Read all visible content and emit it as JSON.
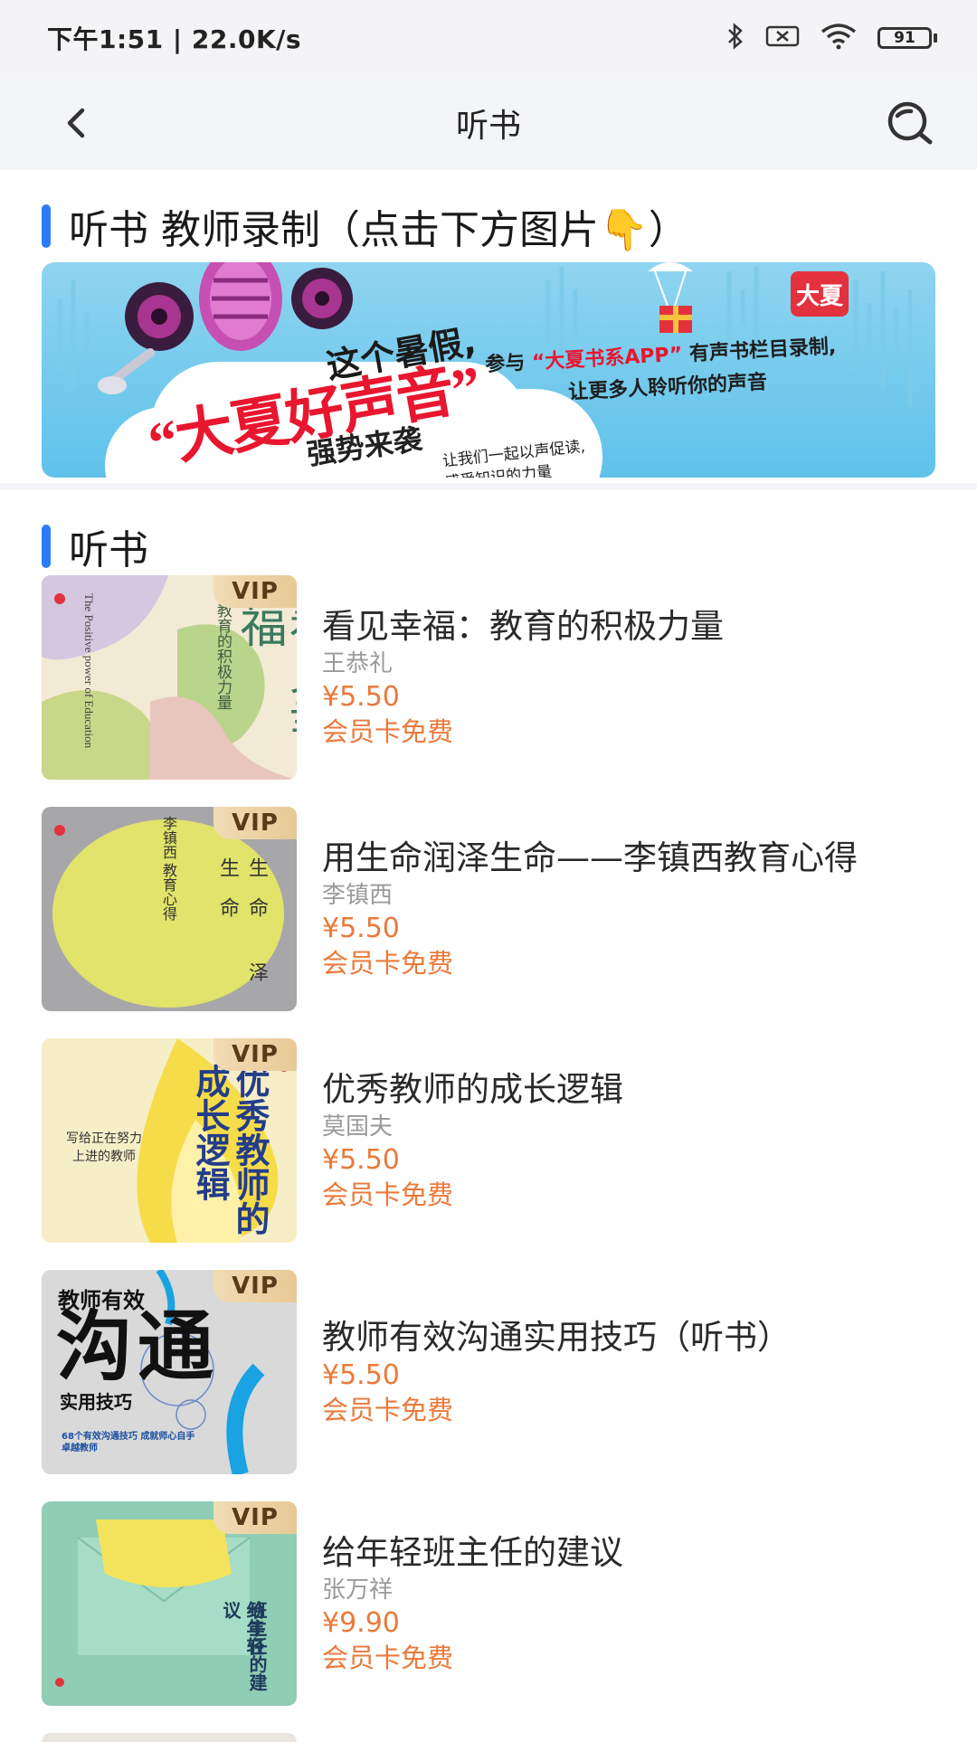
{
  "status_bar": {
    "time_speed": "下午1:51 | 22.0K/s",
    "battery": "91"
  },
  "nav": {
    "title": "听书"
  },
  "recording_section": {
    "title": "听书 教师录制（点击下方图片👇）",
    "banner": {
      "headline": "这个暑假,",
      "big_text": "“大夏好声音”",
      "strong_text": "强势来袭",
      "promo_prefix": "参与",
      "promo_app": "“大夏书系APP”",
      "promo_suffix": "有声书栏目录制,",
      "promo_line2": "让更多人聆听你的声音",
      "promo_line3a": "让我们一起以声促读,",
      "promo_line3b": "感受知识的力量",
      "logo": "大夏"
    }
  },
  "books_section": {
    "title": "听书",
    "vip_label": "VIP",
    "items": [
      {
        "title": "看见幸福：教育的积极力量",
        "author": "王恭礼",
        "price": "¥5.50",
        "member": "会员卡免费",
        "cover_main": "看见幸福",
        "cover_sub": "教育的积极力量",
        "cover_en": "The Positive power of Education"
      },
      {
        "title": "用生命润泽生命——李镇西教育心得",
        "author": "李镇西",
        "price": "¥5.50",
        "member": "会员卡免费",
        "cover_main": "生命 泽生命",
        "cover_sub": "李镇西 教育心得"
      },
      {
        "title": "优秀教师的成长逻辑",
        "author": "莫国夫",
        "price": "¥5.50",
        "member": "会员卡免费",
        "cover_main": "优秀教师的",
        "cover_main2": "成长逻辑",
        "cover_sub": "写给正在努力上进的教师"
      },
      {
        "title": "教师有效沟通实用技巧（听书）",
        "author": "",
        "price": "¥5.50",
        "member": "会员卡免费",
        "cover_top": "教师有效",
        "cover_main": "沟通",
        "cover_sub": "实用技巧",
        "cover_note": "68个有效沟通技巧 成就师心自手卓越教师"
      },
      {
        "title": "给年轻班主任的建议",
        "author": "张万祥",
        "price": "¥9.90",
        "member": "会员卡免费",
        "cover_main": "给年轻",
        "cover_main2": "班主任的建议"
      }
    ]
  },
  "colors": {
    "accent": "#2b7cf6",
    "price": "#ea7a3b"
  }
}
